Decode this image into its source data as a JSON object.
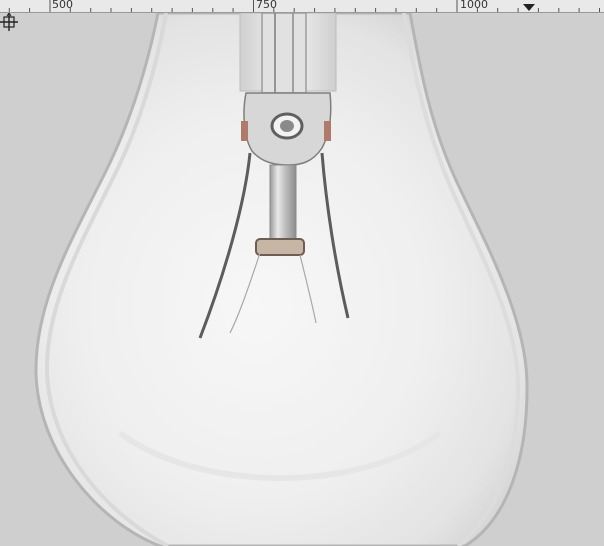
{
  "ruler": {
    "labels": [
      "500",
      "750",
      "1000"
    ],
    "marker_icon": "triangle-down-icon"
  },
  "canvas": {
    "subject_icon": "light-bulb-image",
    "cursor_icon": "move-crosshair-cursor-icon"
  },
  "colors": {
    "background": "#cfcfcf",
    "ruler_bg": "#e9e9e9",
    "bulb_glass": "#f1f1f1",
    "bulb_rim": "#b9b9b9"
  }
}
